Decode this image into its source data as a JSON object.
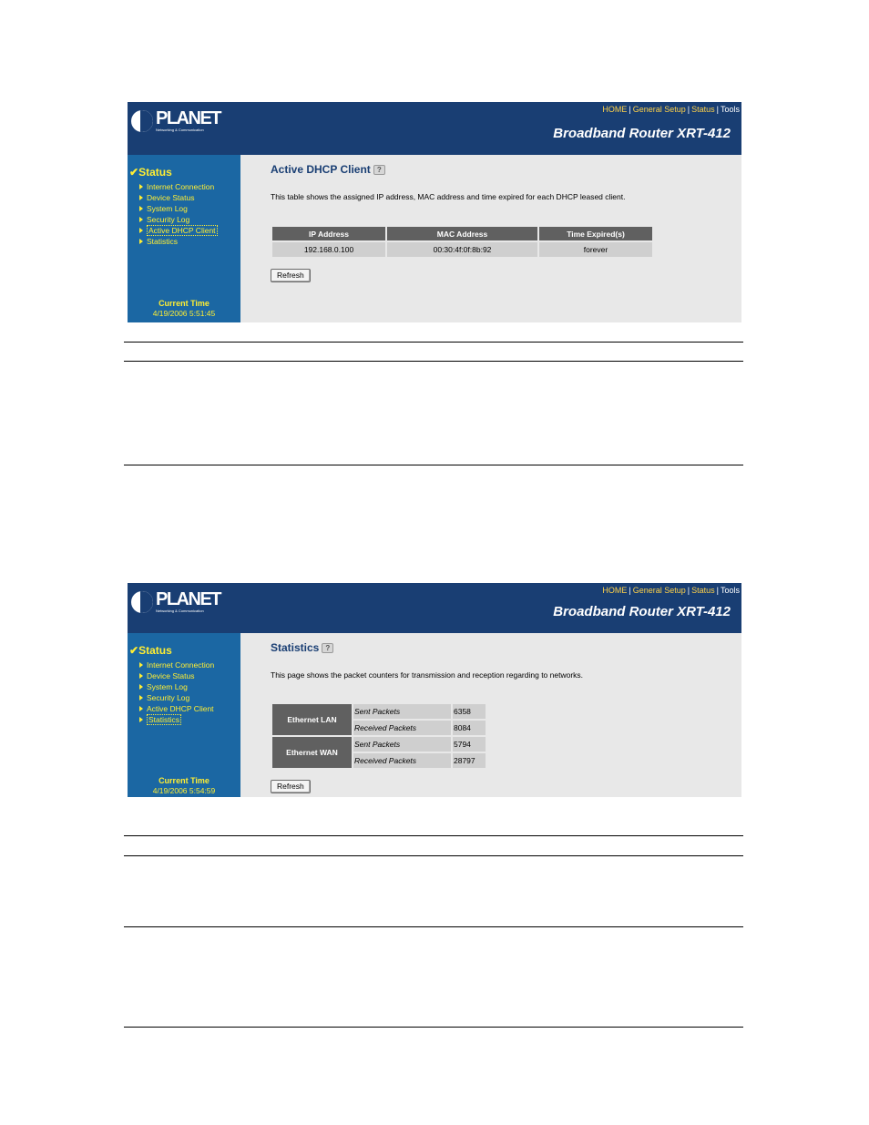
{
  "brand": {
    "name": "PLANET",
    "tagline": "Networking & Communication"
  },
  "top_nav": {
    "home": "HOME",
    "general_setup": "General Setup",
    "status": "Status",
    "tools": "Tools"
  },
  "product_name": "Broadband Router XRT-412",
  "sidebar": {
    "title": "Status",
    "items": [
      {
        "label": "Internet Connection"
      },
      {
        "label": "Device Status"
      },
      {
        "label": "System Log"
      },
      {
        "label": "Security Log"
      },
      {
        "label": "Active DHCP Client"
      },
      {
        "label": "Statistics"
      }
    ],
    "current_time_label": "Current Time"
  },
  "screen1": {
    "page_title": "Active DHCP Client",
    "active_item": "Active DHCP Client",
    "description": "This table shows the assigned IP address, MAC address and time expired for each DHCP leased client.",
    "columns": [
      "IP Address",
      "MAC Address",
      "Time Expired(s)"
    ],
    "rows": [
      {
        "ip": "192.168.0.100",
        "mac": "00:30:4f:0f:8b:92",
        "expired": "forever"
      }
    ],
    "refresh_label": "Refresh",
    "current_time": "4/19/2006 5:51:45"
  },
  "screen2": {
    "page_title": "Statistics",
    "active_item": "Statistics",
    "description": "This page shows the packet counters for transmission and reception regarding to networks.",
    "groups": [
      {
        "name": "Ethernet LAN",
        "sent_label": "Sent Packets",
        "sent": "6358",
        "recv_label": "Received Packets",
        "recv": "8084"
      },
      {
        "name": "Ethernet WAN",
        "sent_label": "Sent Packets",
        "sent": "5794",
        "recv_label": "Received Packets",
        "recv": "28797"
      }
    ],
    "refresh_label": "Refresh",
    "current_time": "4/19/2006 5:54:59"
  },
  "colors": {
    "header": "#193e73",
    "sidebar": "#1b67a3",
    "sidebar_text": "#ffee33",
    "content_bg": "#e8e8e8",
    "table_header": "#606060",
    "table_cell": "#cfcfcf"
  }
}
